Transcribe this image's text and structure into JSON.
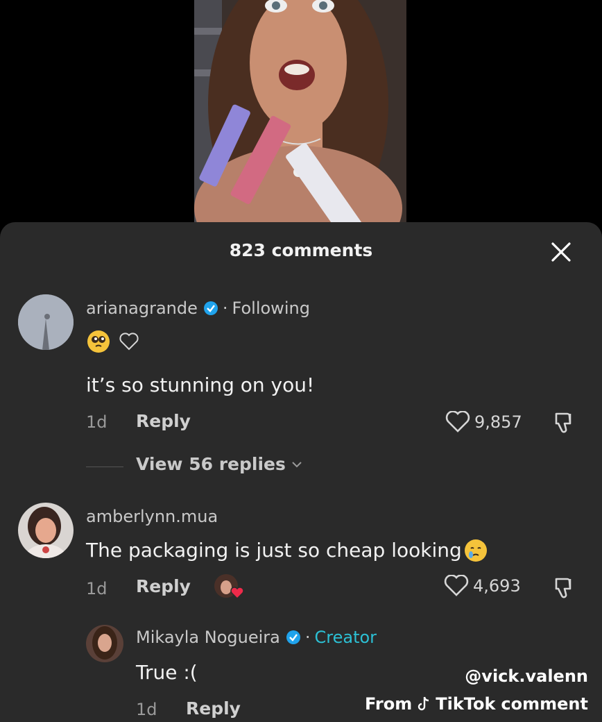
{
  "header": {
    "title": "823 comments",
    "close_icon": "close-icon"
  },
  "comments": [
    {
      "username": "arianagrande",
      "verified": true,
      "separator": "·",
      "status": "Following",
      "reaction_emoji": "pleading-face-emoji",
      "text": "it’s so stunning on you!",
      "time": "1d",
      "reply_label": "Reply",
      "likes": "9,857",
      "view_replies": "View 56 replies"
    },
    {
      "username": "amberlynn.mua",
      "verified": false,
      "text": "The packaging is just so cheap looking",
      "text_emoji": "crying-face-emoji",
      "time": "1d",
      "reply_label": "Reply",
      "likes": "4,693",
      "creator_liked": true
    }
  ],
  "reply": {
    "username": "Mikayla Nogueira",
    "verified": true,
    "separator": "·",
    "badge": "Creator",
    "text": "True :(",
    "time": "1d",
    "reply_label": "Reply"
  },
  "watermark": {
    "handle": "@vick.valenn",
    "source_prefix": "From",
    "brand": "TikTok",
    "source_suffix": "comment"
  },
  "colors": {
    "sheet": "#2a2a2a",
    "creator": "#2cc0d4",
    "verified": "#20a3ec"
  }
}
